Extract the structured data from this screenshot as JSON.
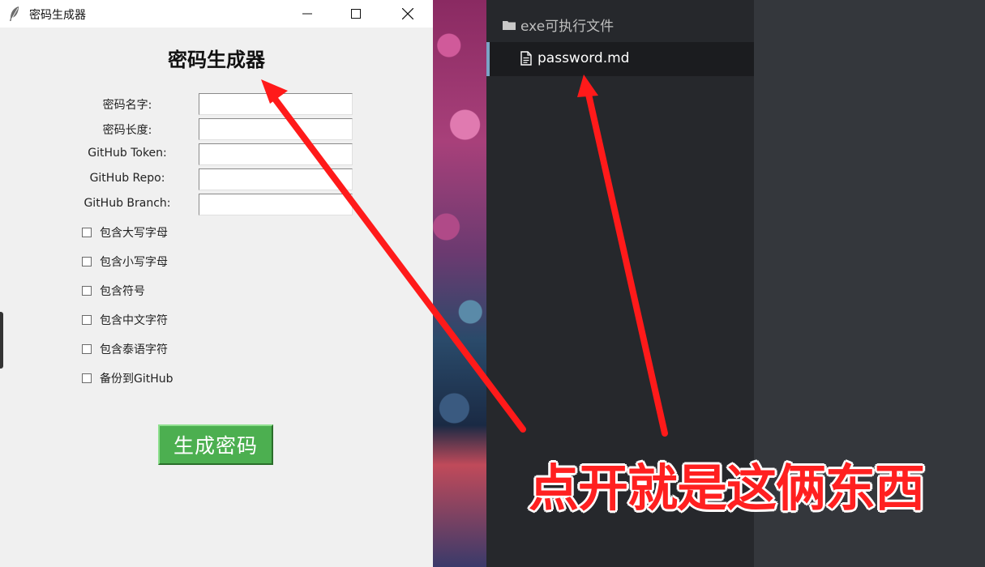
{
  "window": {
    "title": "密码生成器",
    "heading": "密码生成器"
  },
  "form": {
    "fields": [
      {
        "label": "密码名字:",
        "value": ""
      },
      {
        "label": "密码长度:",
        "value": ""
      },
      {
        "label": "GitHub Token:",
        "value": ""
      },
      {
        "label": "GitHub Repo:",
        "value": ""
      },
      {
        "label": "GitHub Branch:",
        "value": ""
      }
    ],
    "checkboxes": [
      {
        "label": "包含大写字母",
        "checked": false
      },
      {
        "label": "包含小写字母",
        "checked": false
      },
      {
        "label": "包含符号",
        "checked": false
      },
      {
        "label": "包含中文字符",
        "checked": false
      },
      {
        "label": "包含泰语字符",
        "checked": false
      },
      {
        "label": "备份到GitHub",
        "checked": false
      }
    ],
    "generate_label": "生成密码"
  },
  "explorer": {
    "folder": {
      "label": "exe可执行文件",
      "icon": "folder-icon"
    },
    "file": {
      "label": "password.md",
      "icon": "file-icon"
    }
  },
  "annotation": {
    "text": "点开就是这俩东西",
    "color": "#ff2020"
  }
}
